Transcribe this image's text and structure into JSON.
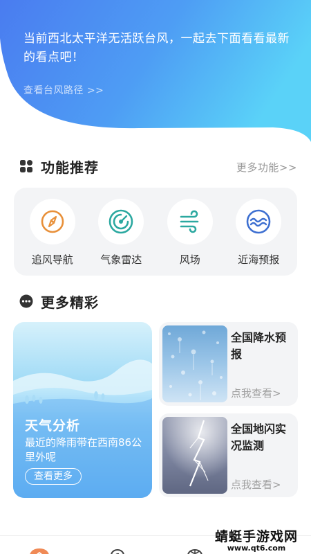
{
  "hero": {
    "message": "当前西北太平洋无活跃台风，一起去下面看看最新的看点吧！",
    "link": "查看台风路径 >>"
  },
  "features_section": {
    "title": "功能推荐",
    "more": "更多功能>>",
    "items": [
      {
        "label": "追风导航",
        "icon": "compass-icon"
      },
      {
        "label": "气象雷达",
        "icon": "radar-icon"
      },
      {
        "label": "风场",
        "icon": "wind-icon"
      },
      {
        "label": "近海预报",
        "icon": "wave-icon"
      }
    ]
  },
  "more_section": {
    "title": "更多精彩",
    "big_card": {
      "title": "天气分析",
      "desc": "最近的降雨带在西南86公里外呢",
      "button": "查看更多"
    },
    "cards": [
      {
        "title": "全国降水预报",
        "link": "点我查看>"
      },
      {
        "title": "全国地闪实况监测",
        "link": "点我查看>"
      }
    ]
  },
  "watermark": {
    "main": "蜻蜓手游戏网",
    "sub": "www.qt6.com"
  },
  "colors": {
    "hero_start": "#4a7df0",
    "hero_end": "#56c9f7",
    "accent_orange": "#e8903a",
    "accent_teal": "#2ba8a0",
    "accent_blue": "#3d6fd1"
  }
}
